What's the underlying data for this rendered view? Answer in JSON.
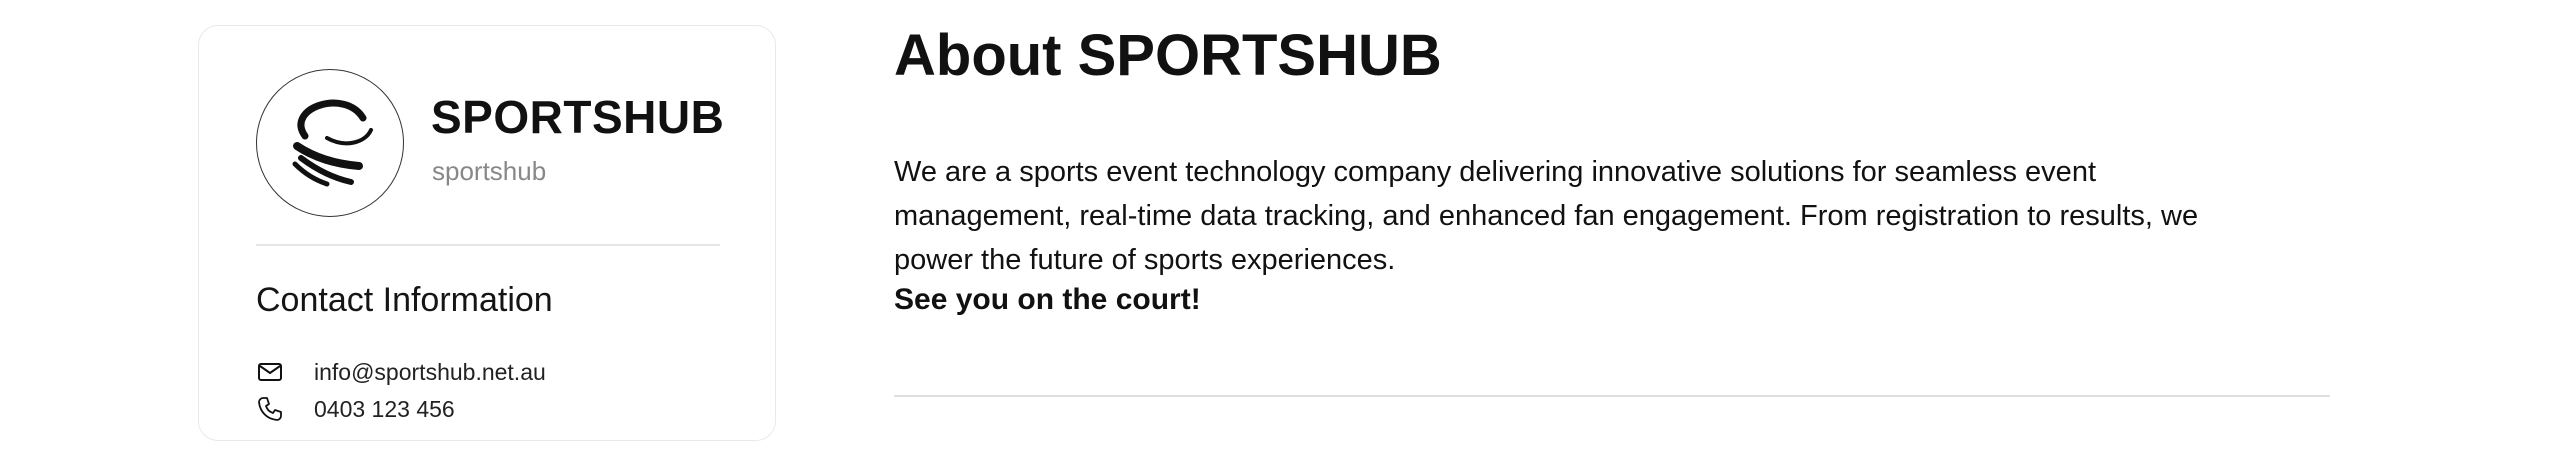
{
  "profile": {
    "name": "SPORTSHUB",
    "handle": "sportshub",
    "logo_icon": "sportshub-logo",
    "contact": {
      "title": "Contact Information",
      "email": {
        "icon": "mail-icon",
        "value": "info@sportshub.net.au"
      },
      "phone": {
        "icon": "phone-icon",
        "value": "0403 123 456"
      }
    }
  },
  "about": {
    "title": "About SPORTSHUB",
    "paragraph_lines": [
      "We are a sports event technology company delivering innovative solutions for seamless event",
      "management, real-time data tracking, and enhanced fan engagement. From registration to results, we",
      "power the future of sports experiences."
    ],
    "tagline": "See you on the court!"
  },
  "colors": {
    "text": "#111111",
    "muted": "#888888",
    "divider": "#e6e6e6",
    "card_border": "#e9e9e9"
  }
}
